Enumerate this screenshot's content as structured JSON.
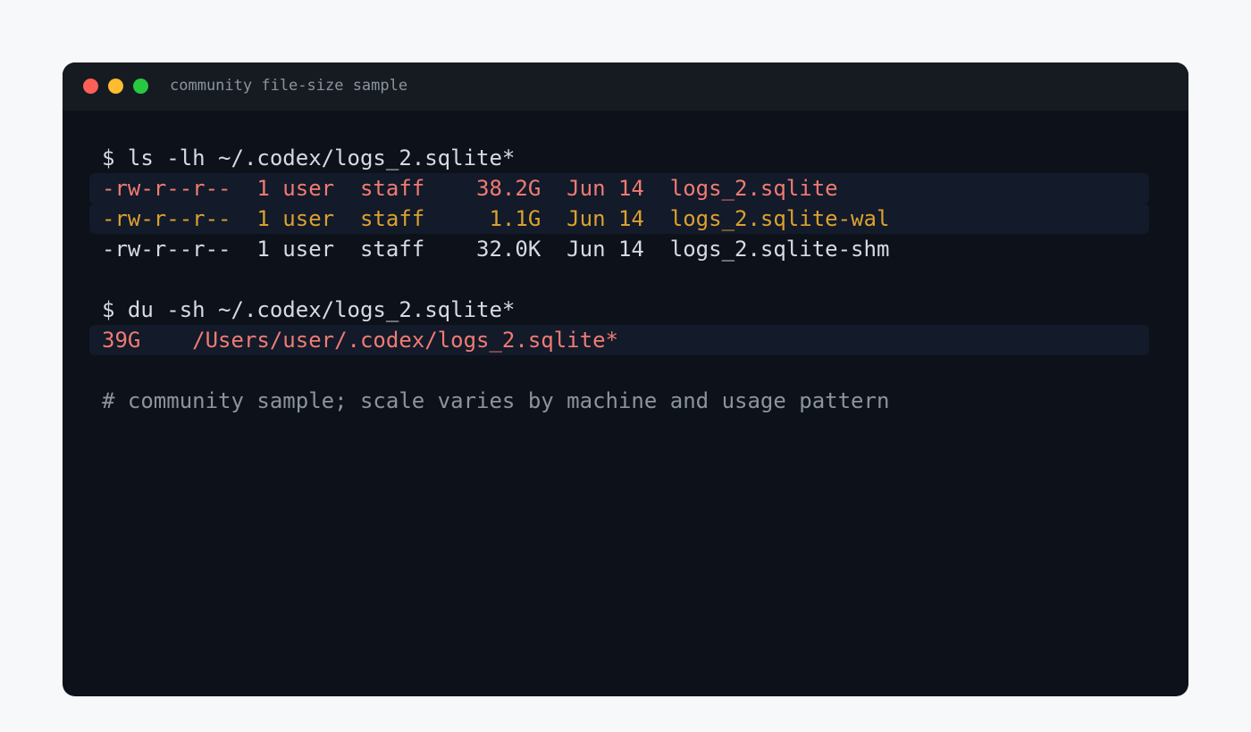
{
  "window": {
    "title": "community file-size sample"
  },
  "terminal": {
    "lines": [
      {
        "text": "$ ls -lh ~/.codex/logs_2.sqlite*",
        "kind": "command"
      },
      {
        "text": "-rw-r--r--  1 user  staff    38.2G  Jun 14  logs_2.sqlite",
        "kind": "output-highlight-red"
      },
      {
        "text": "-rw-r--r--  1 user  staff     1.1G  Jun 14  logs_2.sqlite-wal",
        "kind": "output-highlight-amber"
      },
      {
        "text": "-rw-r--r--  1 user  staff    32.0K  Jun 14  logs_2.sqlite-shm",
        "kind": "output"
      },
      {
        "text": "$ du -sh ~/.codex/logs_2.sqlite*",
        "kind": "command"
      },
      {
        "text": "39G    /Users/user/.codex/logs_2.sqlite*",
        "kind": "output-highlight-red"
      },
      {
        "text": "# community sample; scale varies by machine and usage pattern",
        "kind": "comment"
      }
    ]
  },
  "colors": {
    "page_background": "#f6f8fa",
    "terminal_background": "#0d111a",
    "titlebar_background": "#161b22",
    "highlight_background": "#131a29",
    "default_text": "#d6dbe1",
    "red_text": "#f07b73",
    "amber_text": "#dba130",
    "comment_text": "#8b949e",
    "close_dot": "#ff5f57",
    "minimize_dot": "#febc2e",
    "maximize_dot": "#28c840"
  },
  "icons": [
    "close-dot-icon",
    "minimize-dot-icon",
    "maximize-dot-icon"
  ]
}
